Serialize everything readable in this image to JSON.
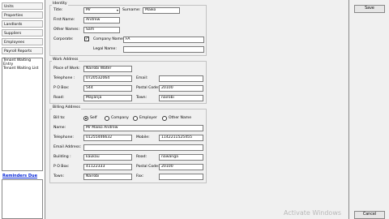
{
  "sidebar": {
    "items": [
      {
        "label": "Units"
      },
      {
        "label": "Properties"
      },
      {
        "label": "Landlords"
      },
      {
        "label": "Suppliers"
      },
      {
        "label": "Employees"
      },
      {
        "label": "Payroll Reports"
      }
    ],
    "list_items": [
      {
        "label": "Tenant Waiting Entry"
      },
      {
        "label": "Tenant Waiting List"
      }
    ],
    "reminders_title": "Reminders Due"
  },
  "identity": {
    "title": "Identity",
    "title_label": "Title:",
    "title_value": "Mr",
    "surname_label": "Surname:",
    "surname_value": "Maiko",
    "first_name_label": "First Name:",
    "first_name_value": "Andrew",
    "other_names_label": "Other Names:",
    "other_names_value": "Sam",
    "corporate_label": "Corporate:",
    "corporate_checked": "✓",
    "company_name_label": "Company Name",
    "company_name_value": "FA",
    "legal_name_label": "Legal Name:",
    "legal_name_value": ""
  },
  "work_address": {
    "title": "Work Address",
    "place_label": "Place of Work:",
    "place_value": "Nairobi Water",
    "telephone_label": "Telephone :",
    "telephone_value": "0720532064",
    "email_label": "Email:",
    "email_value": "",
    "pobox_label": "P O Box:",
    "pobox_value": "544",
    "postal_label": "Postal Code:",
    "postal_value": "20100",
    "road_label": "Road:",
    "road_value": "Mayanja",
    "town_label": "Town:",
    "town_value": "nairobi"
  },
  "billing": {
    "title": "Billing Address",
    "bill_to_label": "Bill to:",
    "options": [
      {
        "label": "Self",
        "selected": true
      },
      {
        "label": "Company",
        "selected": false
      },
      {
        "label": "Employer",
        "selected": false
      },
      {
        "label": "Other Name",
        "selected": false
      }
    ],
    "name_label": "Name:",
    "name_value": "Mr Maiko Andrew",
    "telephone_label": "Telephone:",
    "telephone_value": "01255446632",
    "mobile_label": "Mobile:",
    "mobile_value": "1142211525455",
    "email_label": "Email Address:",
    "email_value": "",
    "building_label": "Building :",
    "building_value": "kaukau",
    "road_label": "Road:",
    "road_value": "nawanga",
    "pobox_label": "P O Box:",
    "pobox_value": "41122333",
    "postal_label": "Postal Code:",
    "postal_value": "20100",
    "town_label": "Town:",
    "town_value": "Nairobi",
    "fax_label": "Fax:",
    "fax_value": ""
  },
  "actions": {
    "save_label": "Save",
    "cancel_label": "Cancel"
  },
  "watermark": "Activate Windows"
}
